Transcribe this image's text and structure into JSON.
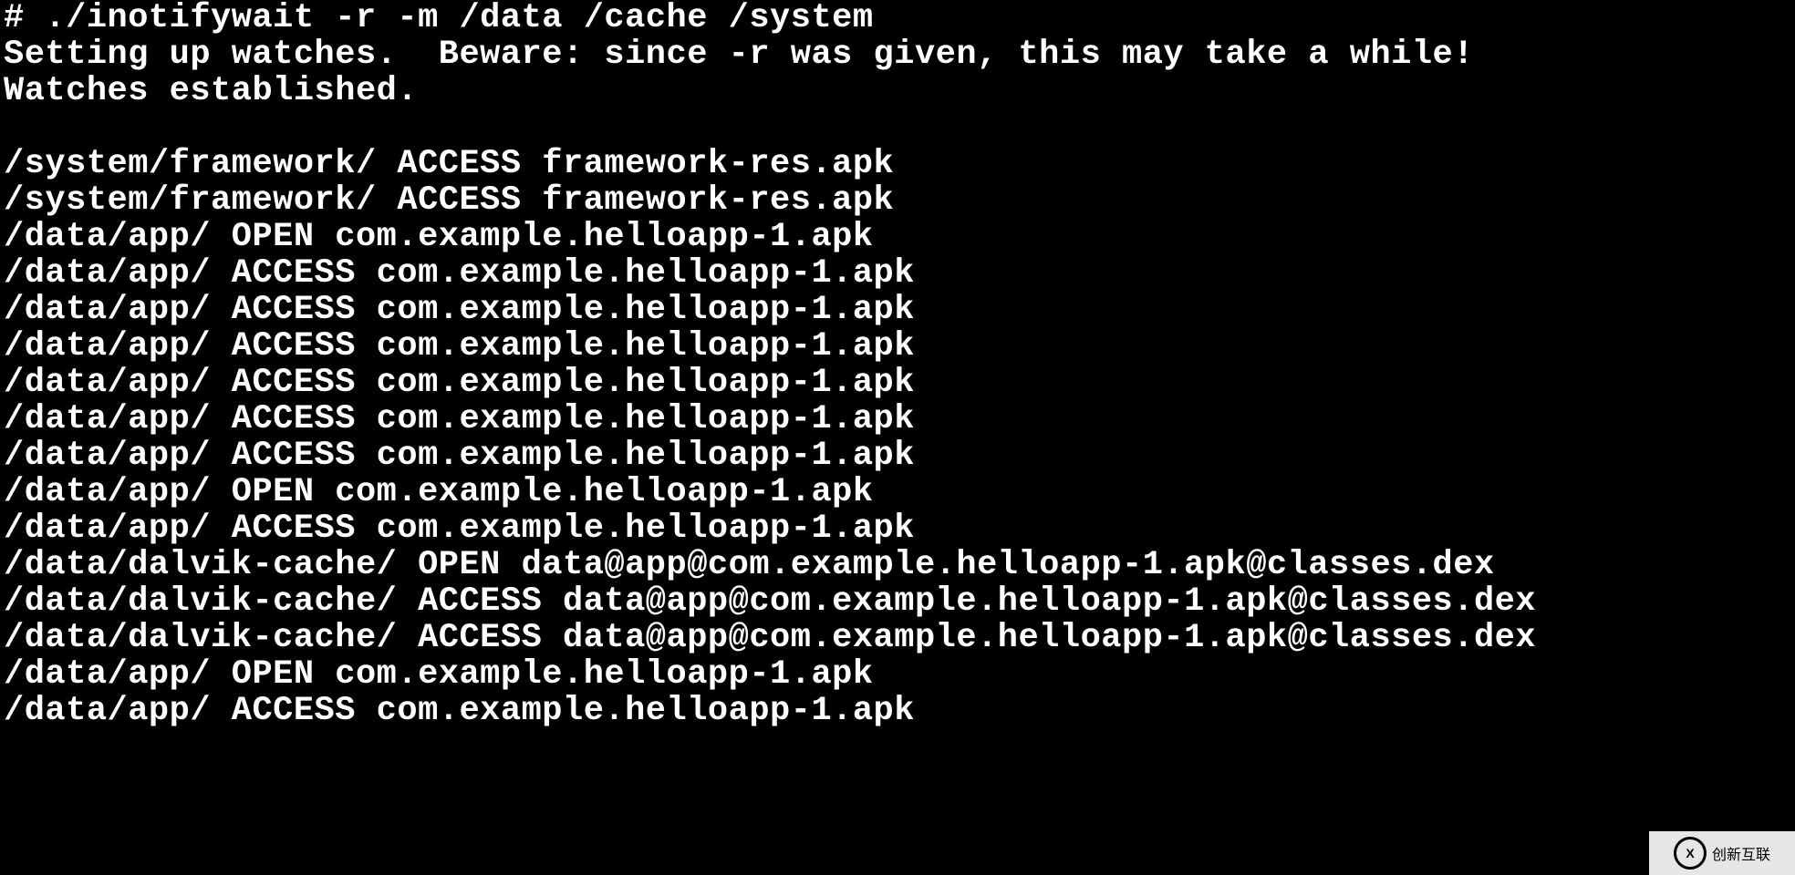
{
  "terminal": {
    "lines": [
      "# ./inotifywait -r -m /data /cache /system",
      "Setting up watches.  Beware: since -r was given, this may take a while!",
      "Watches established.",
      "",
      "/system/framework/ ACCESS framework-res.apk",
      "/system/framework/ ACCESS framework-res.apk",
      "/data/app/ OPEN com.example.helloapp-1.apk",
      "/data/app/ ACCESS com.example.helloapp-1.apk",
      "/data/app/ ACCESS com.example.helloapp-1.apk",
      "/data/app/ ACCESS com.example.helloapp-1.apk",
      "/data/app/ ACCESS com.example.helloapp-1.apk",
      "/data/app/ ACCESS com.example.helloapp-1.apk",
      "/data/app/ ACCESS com.example.helloapp-1.apk",
      "/data/app/ OPEN com.example.helloapp-1.apk",
      "/data/app/ ACCESS com.example.helloapp-1.apk",
      "/data/dalvik-cache/ OPEN data@app@com.example.helloapp-1.apk@classes.dex",
      "/data/dalvik-cache/ ACCESS data@app@com.example.helloapp-1.apk@classes.dex",
      "/data/dalvik-cache/ ACCESS data@app@com.example.helloapp-1.apk@classes.dex",
      "/data/app/ OPEN com.example.helloapp-1.apk",
      "/data/app/ ACCESS com.example.helloapp-1.apk"
    ]
  },
  "watermark": {
    "logo_glyph": "X",
    "text": "创新互联"
  }
}
